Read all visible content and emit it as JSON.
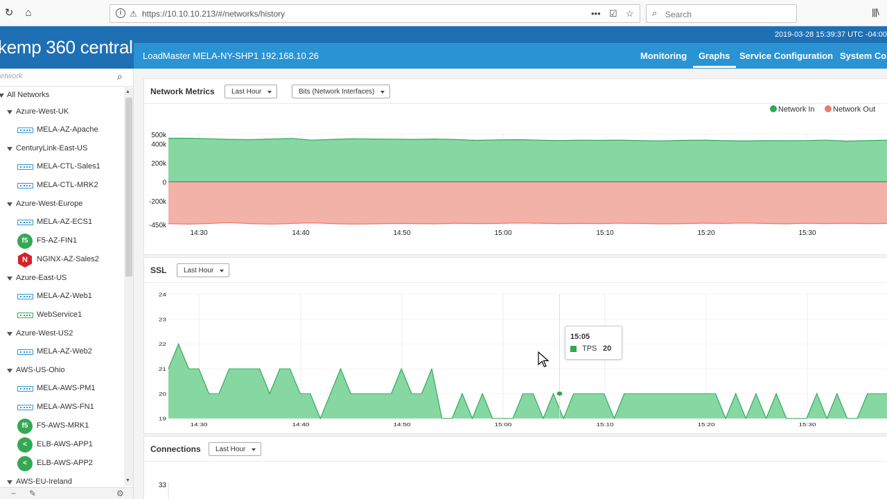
{
  "browser": {
    "url": "https://10.10.10.213/#/networks/history",
    "search_placeholder": "Search",
    "more_label": "•••"
  },
  "header": {
    "timestamp": "2019-03-28 15:39:37 UTC -04:00",
    "brand": "kemp 360 central",
    "loadmaster": "LoadMaster MELA-NY-SHP1 192.168.10.26",
    "nav": [
      "Monitoring",
      "Graphs",
      "Service Configuration",
      "System Con"
    ],
    "active_nav": "Graphs"
  },
  "sidebar": {
    "search_placeholder": "etwork",
    "items": [
      {
        "level": 0,
        "label": "All Networks",
        "type": "group"
      },
      {
        "level": 1,
        "label": "Azure-West-UK",
        "type": "group"
      },
      {
        "level": 2,
        "label": "MELA-AZ-Apache",
        "type": "device",
        "icon": "loadmaster-icon",
        "color": "blue"
      },
      {
        "level": 1,
        "label": "CenturyLink-East-US",
        "type": "group"
      },
      {
        "level": 2,
        "label": "MELA-CTL-Sales1",
        "type": "device",
        "icon": "loadmaster-icon",
        "color": "blue"
      },
      {
        "level": 2,
        "label": "MELA-CTL-MRK2",
        "type": "device",
        "icon": "loadmaster-icon",
        "color": "blue"
      },
      {
        "level": 1,
        "label": "Azure-West-Europe",
        "type": "group"
      },
      {
        "level": 2,
        "label": "MELA-AZ-ECS1",
        "type": "device",
        "icon": "loadmaster-icon",
        "color": "blue"
      },
      {
        "level": 2,
        "label": "F5-AZ-FIN1",
        "type": "device",
        "icon": "f5-icon",
        "color": "green"
      },
      {
        "level": 2,
        "label": "NGINX-AZ-Sales2",
        "type": "device",
        "icon": "nginx-icon",
        "color": "red"
      },
      {
        "level": 1,
        "label": "Azure-East-US",
        "type": "group"
      },
      {
        "level": 2,
        "label": "MELA-AZ-Web1",
        "type": "device",
        "icon": "loadmaster-icon",
        "color": "blue"
      },
      {
        "level": 2,
        "label": "WebService1",
        "type": "device",
        "icon": "loadmaster-icon",
        "color": "green"
      },
      {
        "level": 1,
        "label": "Azure-West-US2",
        "type": "group"
      },
      {
        "level": 2,
        "label": "MELA-AZ-Web2",
        "type": "device",
        "icon": "loadmaster-icon",
        "color": "blue"
      },
      {
        "level": 1,
        "label": "AWS-US-Ohio",
        "type": "group"
      },
      {
        "level": 2,
        "label": "MELA-AWS-PM1",
        "type": "device",
        "icon": "loadmaster-icon",
        "color": "blue"
      },
      {
        "level": 2,
        "label": "MELA-AWS-FN1",
        "type": "device",
        "icon": "loadmaster-icon",
        "color": "blue"
      },
      {
        "level": 2,
        "label": "F5-AWS-MRK1",
        "type": "device",
        "icon": "f5-icon",
        "color": "green"
      },
      {
        "level": 2,
        "label": "ELB-AWS-APP1",
        "type": "device",
        "icon": "elb-icon",
        "color": "green"
      },
      {
        "level": 2,
        "label": "ELB-AWS-APP2",
        "type": "device",
        "icon": "elb-icon",
        "color": "green"
      },
      {
        "level": 1,
        "label": "AWS-EU-Ireland",
        "type": "group"
      }
    ]
  },
  "panels": {
    "network": {
      "title": "Network Metrics",
      "range": "Last Hour",
      "metric": "Bits (Network Interfaces)"
    },
    "ssl": {
      "title": "SSL",
      "range": "Last Hour"
    },
    "connections": {
      "title": "Connections",
      "range": "Last Hour"
    }
  },
  "colors": {
    "in": "#2fa859",
    "in_fill": "#86d7a2",
    "out": "#e87a6c",
    "out_fill": "#f3b2a8"
  },
  "chart_data": [
    {
      "type": "area",
      "title": "Network Metrics",
      "x_ticks": [
        "14:30",
        "14:40",
        "14:50",
        "15:00",
        "15:10",
        "15:20",
        "15:30"
      ],
      "y_ticks": [
        "500k",
        "400k",
        "200k",
        "0",
        "-200k",
        "-450k"
      ],
      "ylim": [
        -450000,
        500000
      ],
      "legend_position": "top-right",
      "series": [
        {
          "name": "Network In",
          "values": [
            460000,
            460000,
            455000,
            448000,
            445000,
            452000,
            458000,
            440000,
            448000,
            455000,
            452000,
            450000,
            448000,
            452000,
            446000,
            438000,
            442000,
            445000,
            440000,
            436000,
            440000,
            438000,
            440000,
            436000,
            432000,
            438000,
            440000,
            436000,
            432000,
            436000,
            434000,
            436000,
            440000,
            430000,
            436000,
            440000
          ]
        },
        {
          "name": "Network Out",
          "values": [
            -440000,
            -445000,
            -438000,
            -430000,
            -440000,
            -445000,
            -438000,
            -432000,
            -440000,
            -445000,
            -442000,
            -438000,
            -440000,
            -442000,
            -436000,
            -440000,
            -438000,
            -434000,
            -436000,
            -440000,
            -438000,
            -440000,
            -436000,
            -438000,
            -442000,
            -440000,
            -436000,
            -438000,
            -434000,
            -438000,
            -442000,
            -436000,
            -440000,
            -436000,
            -440000,
            -438000
          ]
        }
      ]
    },
    {
      "type": "area",
      "title": "SSL",
      "x_ticks": [
        "14:30",
        "14:40",
        "14:50",
        "15:00",
        "15:10",
        "15:20",
        "15:30"
      ],
      "y_ticks": [
        "24",
        "23",
        "22",
        "21",
        "20",
        "19"
      ],
      "ylim": [
        19,
        24
      ],
      "series": [
        {
          "name": "TPS",
          "values": [
            21,
            22,
            21,
            21,
            20,
            20,
            21,
            21,
            21,
            21,
            20,
            21,
            21,
            20,
            20,
            19,
            20,
            21,
            20,
            20,
            20,
            20,
            20,
            21,
            20,
            20,
            21,
            19,
            19,
            20,
            19,
            20,
            19,
            19,
            19,
            20,
            20,
            19,
            20,
            19,
            20,
            20,
            20,
            20,
            19,
            20,
            20,
            20,
            20,
            20,
            20,
            20,
            20,
            20,
            20,
            19,
            20,
            19,
            20,
            19,
            20,
            19,
            19,
            19,
            20,
            19,
            20,
            19,
            19,
            20,
            20,
            20
          ]
        }
      ],
      "tooltip": {
        "time": "15:05",
        "series": "TPS",
        "value": "20"
      }
    },
    {
      "type": "line",
      "title": "Connections",
      "y_ticks": [
        "33"
      ]
    }
  ]
}
